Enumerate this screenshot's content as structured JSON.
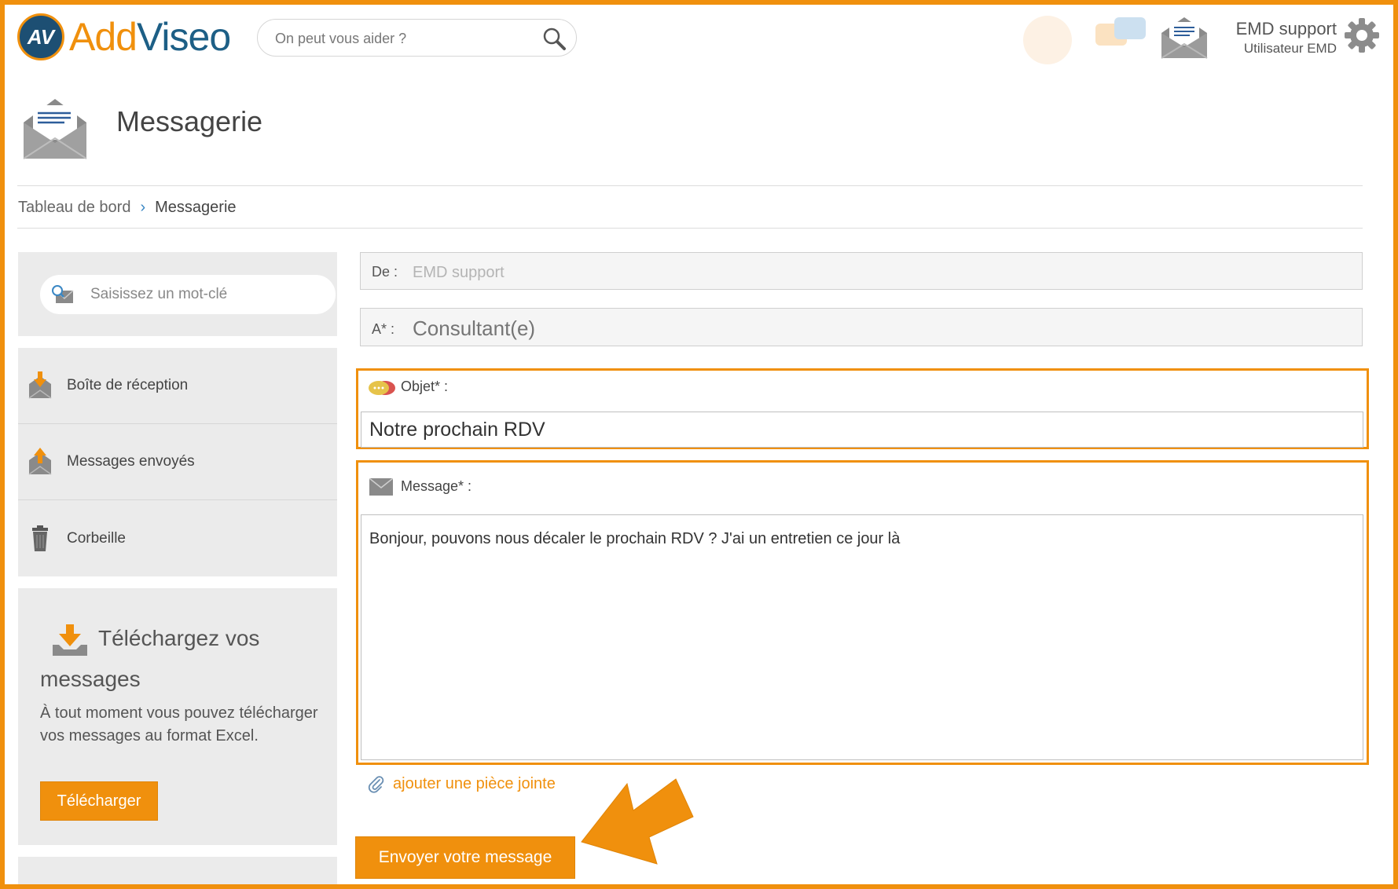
{
  "header": {
    "logo_add": "Add",
    "logo_viseo": "Viseo",
    "search_placeholder": "On peut vous aider ?",
    "user_name": "EMD support",
    "user_role": "Utilisateur EMD"
  },
  "page": {
    "title": "Messagerie"
  },
  "breadcrumb": {
    "home": "Tableau de bord",
    "separator": "›",
    "current": "Messagerie"
  },
  "sidebar": {
    "search_placeholder": "Saisissez un mot-clé",
    "items": [
      {
        "label": "Boîte de réception",
        "icon": "inbox-download-icon"
      },
      {
        "label": "Messages envoyés",
        "icon": "outbox-upload-icon"
      },
      {
        "label": "Corbeille",
        "icon": "trash-icon"
      }
    ],
    "download": {
      "title_line1": "Téléchargez vos",
      "title_line2": "messages",
      "text": "À tout moment vous pouvez télécharger vos messages au format Excel.",
      "button": "Télécharger"
    }
  },
  "form": {
    "from_label": "De :",
    "from_value": "EMD support",
    "to_label": "A* :",
    "to_placeholder": "Consultant(e)",
    "subject_label": "Objet* :",
    "subject_value": "Notre prochain RDV",
    "message_label": "Message* :",
    "message_value": "Bonjour, pouvons nous décaler le prochain RDV ? J'ai un entretien ce jour là",
    "attach_label": "ajouter une pièce jointe",
    "send_button": "Envoyer votre message"
  },
  "colors": {
    "accent": "#f0900d",
    "brand_blue": "#1d5f86",
    "panel_bg": "#ebebeb"
  }
}
